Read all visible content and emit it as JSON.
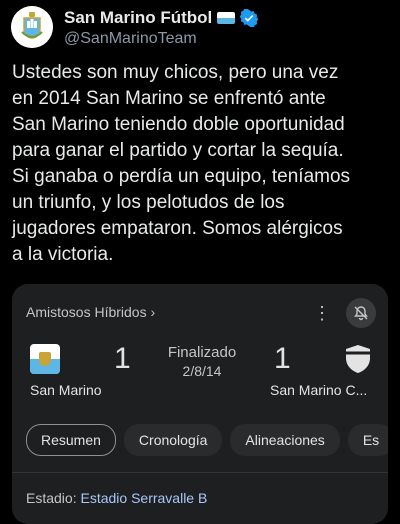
{
  "account": {
    "name": "San Marino Fútbol",
    "handle": "@SanMarinoTeam"
  },
  "tweet": {
    "text": "Ustedes son muy chicos, pero una vez\nen 2014 San Marino se enfrentó ante\nSan Marino teniendo doble oportunidad\npara ganar el partido y cortar la sequía.\nSi ganaba o perdía un equipo, teníamos\nun triunfo, y los pelotudos de los\njugadores empataron. Somos alérgicos\na la victoria."
  },
  "card": {
    "competition": "Amistosos Híbridos ›",
    "status": "Finalizado",
    "date": "2/8/14",
    "home": {
      "name": "San Marino",
      "score": "1"
    },
    "away": {
      "name": "San Marino C...",
      "score": "1"
    },
    "tabs": [
      "Resumen",
      "Cronología",
      "Alineaciones",
      "Es"
    ],
    "stadium_label": "Estadio: ",
    "stadium_value": "Estadio Serravalle B"
  },
  "colors": {
    "background": "#000000",
    "card": "#1e1f20",
    "link": "#a8c7fa",
    "verified": "#1d9bf0",
    "flag_blue": "#5eb6e4"
  }
}
